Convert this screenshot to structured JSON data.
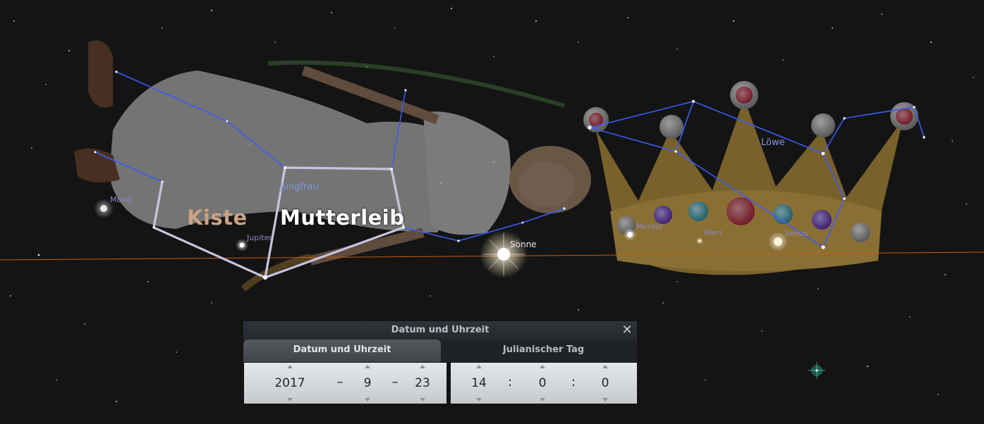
{
  "sky": {
    "constellations": {
      "virgo": "Jungfrau",
      "leo": "Löwe"
    },
    "custom_labels": {
      "kiste": "Kiste",
      "mutterleib": "Mutterleib"
    },
    "planets": {
      "moon": "Mond",
      "jupiter": "Jupiter",
      "sun": "Sonne",
      "mercury": "Merkur",
      "mars": "Mars",
      "venus": "Venus"
    },
    "colors": {
      "constellation_lines": "#3d5cf5",
      "ecliptic": "#c0601a",
      "asterism_lines": "#c8c4de"
    }
  },
  "dialog": {
    "title": "Datum und Uhrzeit",
    "close_glyph": "✕",
    "tabs": {
      "date_time": "Datum und Uhrzeit",
      "julian_day": "Julianischer Tag"
    },
    "date": {
      "year": "2017",
      "month": "9",
      "day": "23",
      "separator": "–"
    },
    "time": {
      "hour": "14",
      "minute": "0",
      "second": "0",
      "separator": ":"
    }
  }
}
